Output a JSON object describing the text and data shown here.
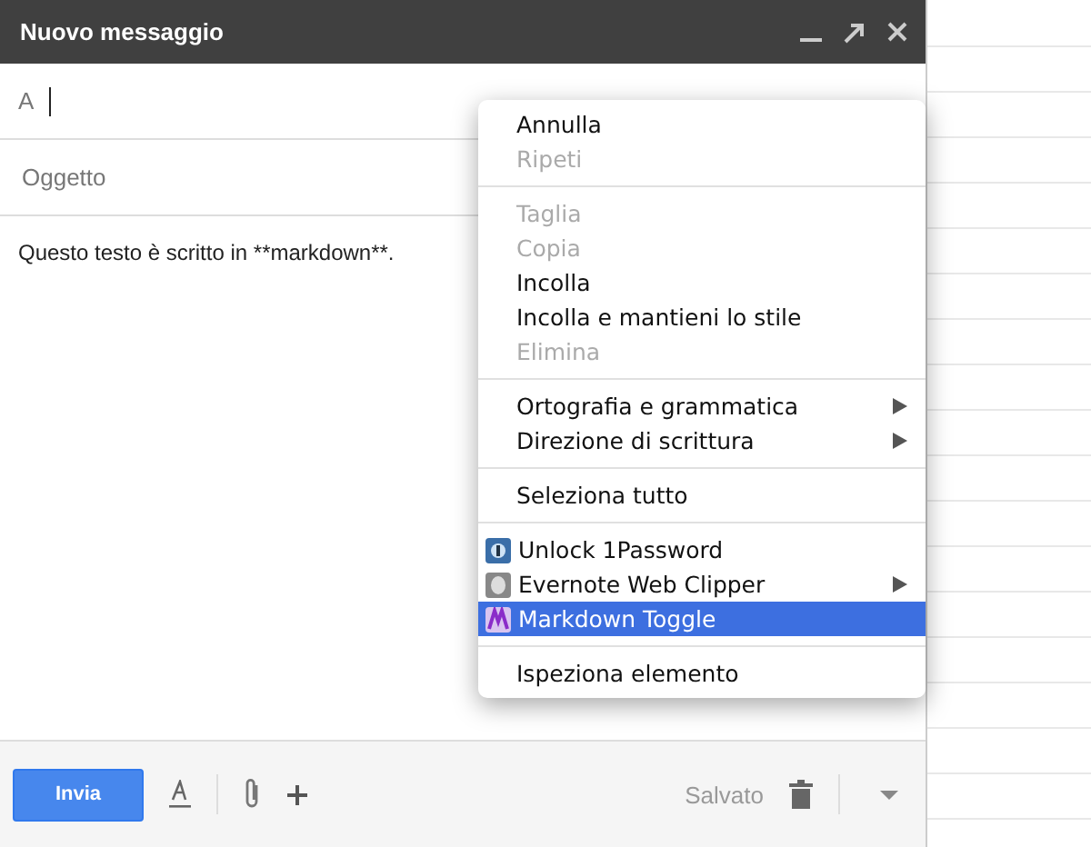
{
  "window": {
    "title": "Nuovo messaggio"
  },
  "to_field": {
    "label": "A"
  },
  "subject": {
    "placeholder": "Oggetto"
  },
  "body": {
    "text": "Questo testo è scritto in **markdown**."
  },
  "context_menu": [
    {
      "kind": "item",
      "label": "Annulla",
      "disabled": false,
      "submenu": false,
      "selected": false
    },
    {
      "kind": "item",
      "label": "Ripeti",
      "disabled": true,
      "submenu": false,
      "selected": false
    },
    {
      "kind": "separator"
    },
    {
      "kind": "item",
      "label": "Taglia",
      "disabled": true,
      "submenu": false,
      "selected": false
    },
    {
      "kind": "item",
      "label": "Copia",
      "disabled": true,
      "submenu": false,
      "selected": false
    },
    {
      "kind": "item",
      "label": "Incolla",
      "disabled": false,
      "submenu": false,
      "selected": false
    },
    {
      "kind": "item",
      "label": "Incolla e mantieni lo stile",
      "disabled": false,
      "submenu": false,
      "selected": false
    },
    {
      "kind": "item",
      "label": "Elimina",
      "disabled": true,
      "submenu": false,
      "selected": false
    },
    {
      "kind": "separator"
    },
    {
      "kind": "item",
      "label": "Ortografia e grammatica",
      "disabled": false,
      "submenu": true,
      "selected": false
    },
    {
      "kind": "item",
      "label": "Direzione di scrittura",
      "disabled": false,
      "submenu": true,
      "selected": false
    },
    {
      "kind": "separator"
    },
    {
      "kind": "item",
      "label": "Seleziona tutto",
      "disabled": false,
      "submenu": false,
      "selected": false
    },
    {
      "kind": "separator"
    },
    {
      "kind": "extension",
      "label": "Unlock 1Password",
      "disabled": false,
      "submenu": false,
      "selected": false
    },
    {
      "kind": "extension",
      "label": "Evernote Web Clipper",
      "disabled": false,
      "submenu": true,
      "selected": false
    },
    {
      "kind": "extension",
      "label": "Markdown Toggle",
      "disabled": false,
      "submenu": false,
      "selected": true
    },
    {
      "kind": "separator"
    },
    {
      "kind": "item",
      "label": "Ispeziona elemento",
      "disabled": false,
      "submenu": false,
      "selected": false
    }
  ],
  "footer": {
    "send": "Invia",
    "status": "Salvato"
  }
}
